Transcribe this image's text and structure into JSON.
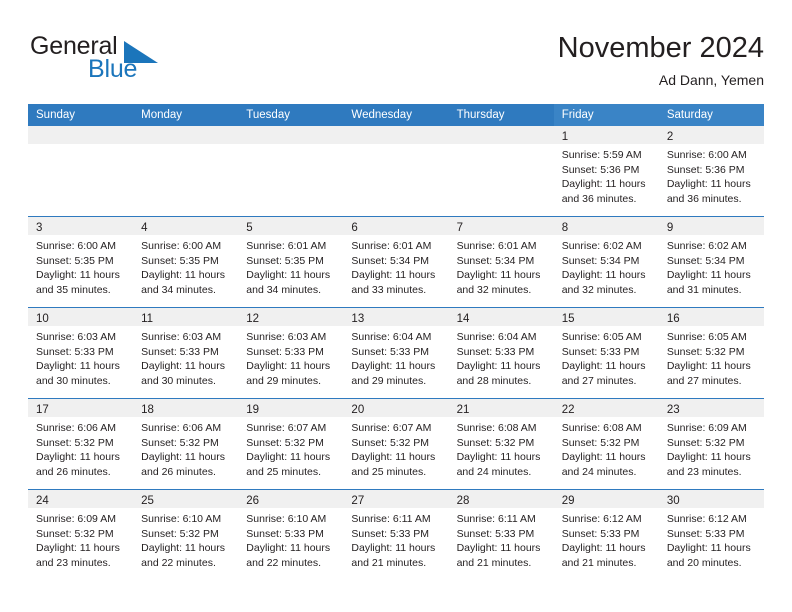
{
  "brand": {
    "name_part1": "General",
    "name_part2": "Blue",
    "logo_icon": "triangle-icon",
    "accent_color": "#1b75bb"
  },
  "header": {
    "month_title": "November 2024",
    "location": "Ad Dann, Yemen"
  },
  "theme": {
    "header_blue": "#2f7abf",
    "header_blue_weekend": "#3a84c6",
    "daynum_band": "#f0f0f0",
    "text": "#231f20"
  },
  "columns": [
    {
      "label": "Sunday",
      "weekend": false
    },
    {
      "label": "Monday",
      "weekend": false
    },
    {
      "label": "Tuesday",
      "weekend": false
    },
    {
      "label": "Wednesday",
      "weekend": false
    },
    {
      "label": "Thursday",
      "weekend": false
    },
    {
      "label": "Friday",
      "weekend": true
    },
    {
      "label": "Saturday",
      "weekend": true
    }
  ],
  "weeks": [
    [
      {
        "day": "",
        "lines": []
      },
      {
        "day": "",
        "lines": []
      },
      {
        "day": "",
        "lines": []
      },
      {
        "day": "",
        "lines": []
      },
      {
        "day": "",
        "lines": []
      },
      {
        "day": "1",
        "lines": [
          "Sunrise: 5:59 AM",
          "Sunset: 5:36 PM",
          "Daylight: 11 hours and 36 minutes."
        ]
      },
      {
        "day": "2",
        "lines": [
          "Sunrise: 6:00 AM",
          "Sunset: 5:36 PM",
          "Daylight: 11 hours and 36 minutes."
        ]
      }
    ],
    [
      {
        "day": "3",
        "lines": [
          "Sunrise: 6:00 AM",
          "Sunset: 5:35 PM",
          "Daylight: 11 hours and 35 minutes."
        ]
      },
      {
        "day": "4",
        "lines": [
          "Sunrise: 6:00 AM",
          "Sunset: 5:35 PM",
          "Daylight: 11 hours and 34 minutes."
        ]
      },
      {
        "day": "5",
        "lines": [
          "Sunrise: 6:01 AM",
          "Sunset: 5:35 PM",
          "Daylight: 11 hours and 34 minutes."
        ]
      },
      {
        "day": "6",
        "lines": [
          "Sunrise: 6:01 AM",
          "Sunset: 5:34 PM",
          "Daylight: 11 hours and 33 minutes."
        ]
      },
      {
        "day": "7",
        "lines": [
          "Sunrise: 6:01 AM",
          "Sunset: 5:34 PM",
          "Daylight: 11 hours and 32 minutes."
        ]
      },
      {
        "day": "8",
        "lines": [
          "Sunrise: 6:02 AM",
          "Sunset: 5:34 PM",
          "Daylight: 11 hours and 32 minutes."
        ]
      },
      {
        "day": "9",
        "lines": [
          "Sunrise: 6:02 AM",
          "Sunset: 5:34 PM",
          "Daylight: 11 hours and 31 minutes."
        ]
      }
    ],
    [
      {
        "day": "10",
        "lines": [
          "Sunrise: 6:03 AM",
          "Sunset: 5:33 PM",
          "Daylight: 11 hours and 30 minutes."
        ]
      },
      {
        "day": "11",
        "lines": [
          "Sunrise: 6:03 AM",
          "Sunset: 5:33 PM",
          "Daylight: 11 hours and 30 minutes."
        ]
      },
      {
        "day": "12",
        "lines": [
          "Sunrise: 6:03 AM",
          "Sunset: 5:33 PM",
          "Daylight: 11 hours and 29 minutes."
        ]
      },
      {
        "day": "13",
        "lines": [
          "Sunrise: 6:04 AM",
          "Sunset: 5:33 PM",
          "Daylight: 11 hours and 29 minutes."
        ]
      },
      {
        "day": "14",
        "lines": [
          "Sunrise: 6:04 AM",
          "Sunset: 5:33 PM",
          "Daylight: 11 hours and 28 minutes."
        ]
      },
      {
        "day": "15",
        "lines": [
          "Sunrise: 6:05 AM",
          "Sunset: 5:33 PM",
          "Daylight: 11 hours and 27 minutes."
        ]
      },
      {
        "day": "16",
        "lines": [
          "Sunrise: 6:05 AM",
          "Sunset: 5:32 PM",
          "Daylight: 11 hours and 27 minutes."
        ]
      }
    ],
    [
      {
        "day": "17",
        "lines": [
          "Sunrise: 6:06 AM",
          "Sunset: 5:32 PM",
          "Daylight: 11 hours and 26 minutes."
        ]
      },
      {
        "day": "18",
        "lines": [
          "Sunrise: 6:06 AM",
          "Sunset: 5:32 PM",
          "Daylight: 11 hours and 26 minutes."
        ]
      },
      {
        "day": "19",
        "lines": [
          "Sunrise: 6:07 AM",
          "Sunset: 5:32 PM",
          "Daylight: 11 hours and 25 minutes."
        ]
      },
      {
        "day": "20",
        "lines": [
          "Sunrise: 6:07 AM",
          "Sunset: 5:32 PM",
          "Daylight: 11 hours and 25 minutes."
        ]
      },
      {
        "day": "21",
        "lines": [
          "Sunrise: 6:08 AM",
          "Sunset: 5:32 PM",
          "Daylight: 11 hours and 24 minutes."
        ]
      },
      {
        "day": "22",
        "lines": [
          "Sunrise: 6:08 AM",
          "Sunset: 5:32 PM",
          "Daylight: 11 hours and 24 minutes."
        ]
      },
      {
        "day": "23",
        "lines": [
          "Sunrise: 6:09 AM",
          "Sunset: 5:32 PM",
          "Daylight: 11 hours and 23 minutes."
        ]
      }
    ],
    [
      {
        "day": "24",
        "lines": [
          "Sunrise: 6:09 AM",
          "Sunset: 5:32 PM",
          "Daylight: 11 hours and 23 minutes."
        ]
      },
      {
        "day": "25",
        "lines": [
          "Sunrise: 6:10 AM",
          "Sunset: 5:32 PM",
          "Daylight: 11 hours and 22 minutes."
        ]
      },
      {
        "day": "26",
        "lines": [
          "Sunrise: 6:10 AM",
          "Sunset: 5:33 PM",
          "Daylight: 11 hours and 22 minutes."
        ]
      },
      {
        "day": "27",
        "lines": [
          "Sunrise: 6:11 AM",
          "Sunset: 5:33 PM",
          "Daylight: 11 hours and 21 minutes."
        ]
      },
      {
        "day": "28",
        "lines": [
          "Sunrise: 6:11 AM",
          "Sunset: 5:33 PM",
          "Daylight: 11 hours and 21 minutes."
        ]
      },
      {
        "day": "29",
        "lines": [
          "Sunrise: 6:12 AM",
          "Sunset: 5:33 PM",
          "Daylight: 11 hours and 21 minutes."
        ]
      },
      {
        "day": "30",
        "lines": [
          "Sunrise: 6:12 AM",
          "Sunset: 5:33 PM",
          "Daylight: 11 hours and 20 minutes."
        ]
      }
    ]
  ]
}
